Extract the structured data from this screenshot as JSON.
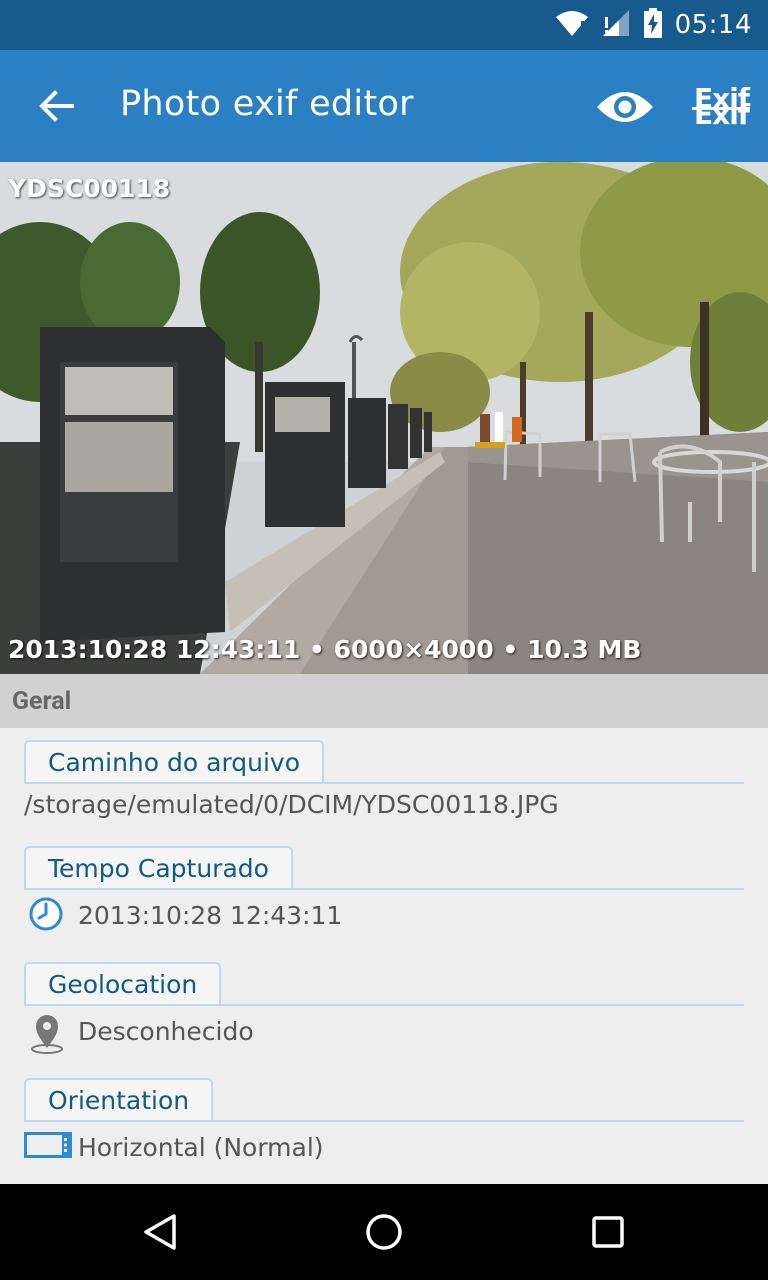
{
  "status_bar": {
    "time": "05:14",
    "icons": [
      "wifi-icon",
      "signal-icon",
      "battery-charging-icon"
    ]
  },
  "app_bar": {
    "title": "Photo exif editor",
    "back_icon": "arrow-left-icon",
    "view_icon": "eye-icon",
    "exif_icon": "exif-strike-icon",
    "exif_text_top": "Exif",
    "exif_text_bottom": "Exif",
    "background": "#2a80c2"
  },
  "photo": {
    "name": "YDSC00118",
    "info": "2013:10:28 12:43:11 • 6000×4000 • 10.3 MB"
  },
  "section": {
    "title": "Geral"
  },
  "fields": [
    {
      "label": "Caminho do arquivo",
      "value": "/storage/emulated/0/DCIM/YDSC00118.JPG",
      "icon": ""
    },
    {
      "label": "Tempo Capturado",
      "value": "2013:10:28 12:43:11",
      "icon": "clock-icon"
    },
    {
      "label": "Geolocation",
      "value": "Desconhecido",
      "icon": "location-pin-icon"
    },
    {
      "label": "Orientation",
      "value": "Horizontal (Normal)",
      "icon": "landscape-frame-icon"
    }
  ],
  "nav_bar": {
    "buttons": [
      "back-triangle-icon",
      "home-circle-icon",
      "recents-square-icon"
    ]
  },
  "colors": {
    "status_bar": "#175b8e",
    "app_bar": "#2a80c2",
    "label_text": "#0f5a87",
    "label_border": "#bcd9ef",
    "accent_icon": "#2e8ad6"
  }
}
